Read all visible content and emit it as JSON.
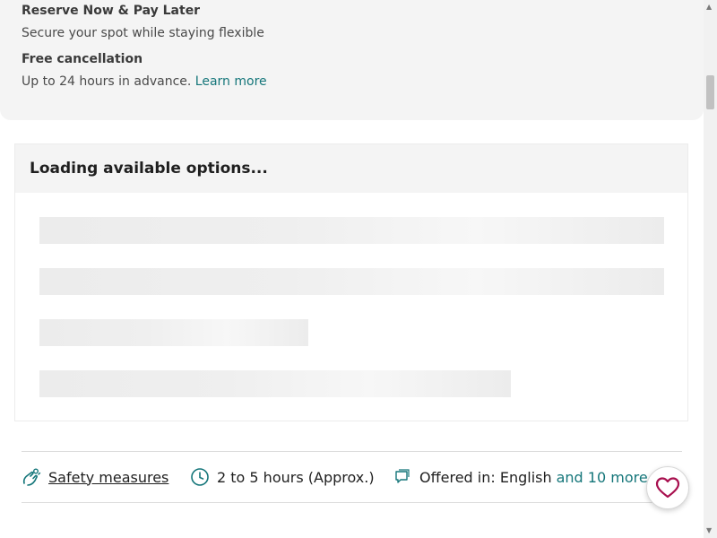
{
  "features": {
    "reserve_title": "Reserve Now & Pay Later",
    "reserve_desc": "Secure your spot while staying flexible",
    "cancel_title": "Free cancellation",
    "cancel_desc": "Up to 24 hours in advance.",
    "learn_more": "Learn more"
  },
  "options": {
    "loading_title": "Loading available options..."
  },
  "info_bar": {
    "safety_label": "Safety measures",
    "duration_label": "2 to 5 hours (Approx.)",
    "languages_label": "Offered in: English",
    "languages_more": "and 10 more"
  },
  "icons": {
    "safety": "hands-icon",
    "duration": "clock-icon",
    "languages": "speech-bubble-icon",
    "wishlist": "heart-icon"
  },
  "colors": {
    "accent": "#15767a",
    "heart": "#a8104f"
  }
}
